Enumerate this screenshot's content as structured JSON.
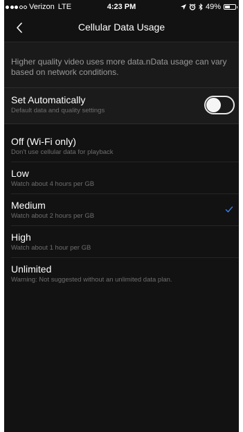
{
  "status_bar": {
    "carrier": "Verizon",
    "network": "LTE",
    "time": "4:23 PM",
    "battery": "49%",
    "battery_level": 0.49,
    "signal_bars_filled": 3,
    "icons": [
      "location-icon",
      "alarm-icon",
      "bluetooth-icon",
      "battery-icon"
    ]
  },
  "nav": {
    "back_icon": "chevron-left-icon",
    "title": "Cellular Data Usage"
  },
  "info": {
    "text": "Higher quality video uses more data.nData usage can vary based on network conditions."
  },
  "auto": {
    "label": "Set Automatically",
    "description": "Default data and quality settings",
    "toggle_on": false
  },
  "options": [
    {
      "label": "Off (Wi-Fi only)",
      "description": "Don't use cellular data for playback",
      "selected": false
    },
    {
      "label": "Low",
      "description": "Watch about 4 hours per GB",
      "selected": false
    },
    {
      "label": "Medium",
      "description": "Watch about 2 hours per GB",
      "selected": true
    },
    {
      "label": "High",
      "description": "Watch about 1 hour per GB",
      "selected": false
    },
    {
      "label": "Unlimited",
      "description": "Warning: Not suggested without an unlimited data plan.",
      "selected": false
    }
  ],
  "colors": {
    "background": "#121212",
    "section_background": "#1b1b1b",
    "text_primary": "#ffffff",
    "text_secondary": "#6e6e6e",
    "accent_check": "#3d7ddb"
  }
}
